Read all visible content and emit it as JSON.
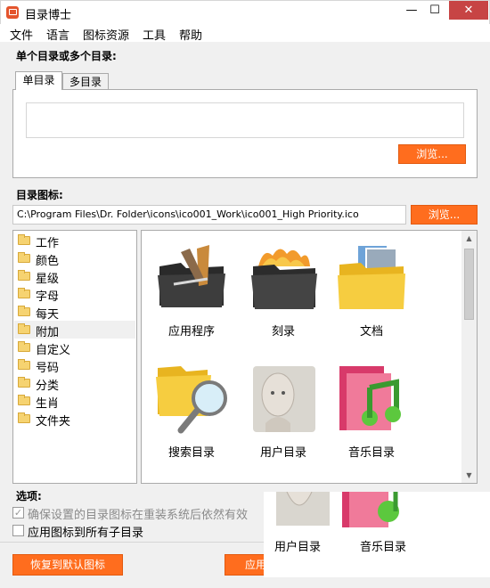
{
  "window": {
    "title": "目录博士",
    "buttons": {
      "minimize": "—",
      "maximize": "☐",
      "close": "✕"
    }
  },
  "menu": [
    "文件",
    "语言",
    "图标资源",
    "工具",
    "帮助"
  ],
  "single_multi": {
    "label": "单个目录或多个目录:",
    "tabs": [
      "单目录",
      "多目录"
    ],
    "input_value": "",
    "browse": "浏览..."
  },
  "icon_section": {
    "label": "目录图标:",
    "path": "C:\\Program Files\\Dr. Folder\\icons\\ico001_Work\\ico001_High Priority.ico",
    "browse": "浏览..."
  },
  "tree": {
    "items": [
      "工作",
      "颜色",
      "星级",
      "字母",
      "每天",
      "附加",
      "自定义",
      "号码",
      "分类",
      "生肖",
      "文件夹"
    ],
    "selected": "附加"
  },
  "icons": {
    "labels": [
      "应用程序",
      "刻录",
      "文档",
      "搜索目录",
      "用户目录",
      "音乐目录"
    ]
  },
  "options": {
    "label": "选项:",
    "opt1": "确保设置的目录图标在重装系统后依然有效",
    "opt1_checked": true,
    "opt1_disabled": true,
    "opt2": "应用图标到所有子目录",
    "opt2_checked": false
  },
  "bottom": {
    "restore": "恢复到默认图标",
    "apply": "应用"
  },
  "overlay": {
    "labels": [
      "用户目录",
      "音乐目录"
    ]
  },
  "colors": {
    "accent": "#ff6d1e",
    "close_button": "#c74444"
  }
}
